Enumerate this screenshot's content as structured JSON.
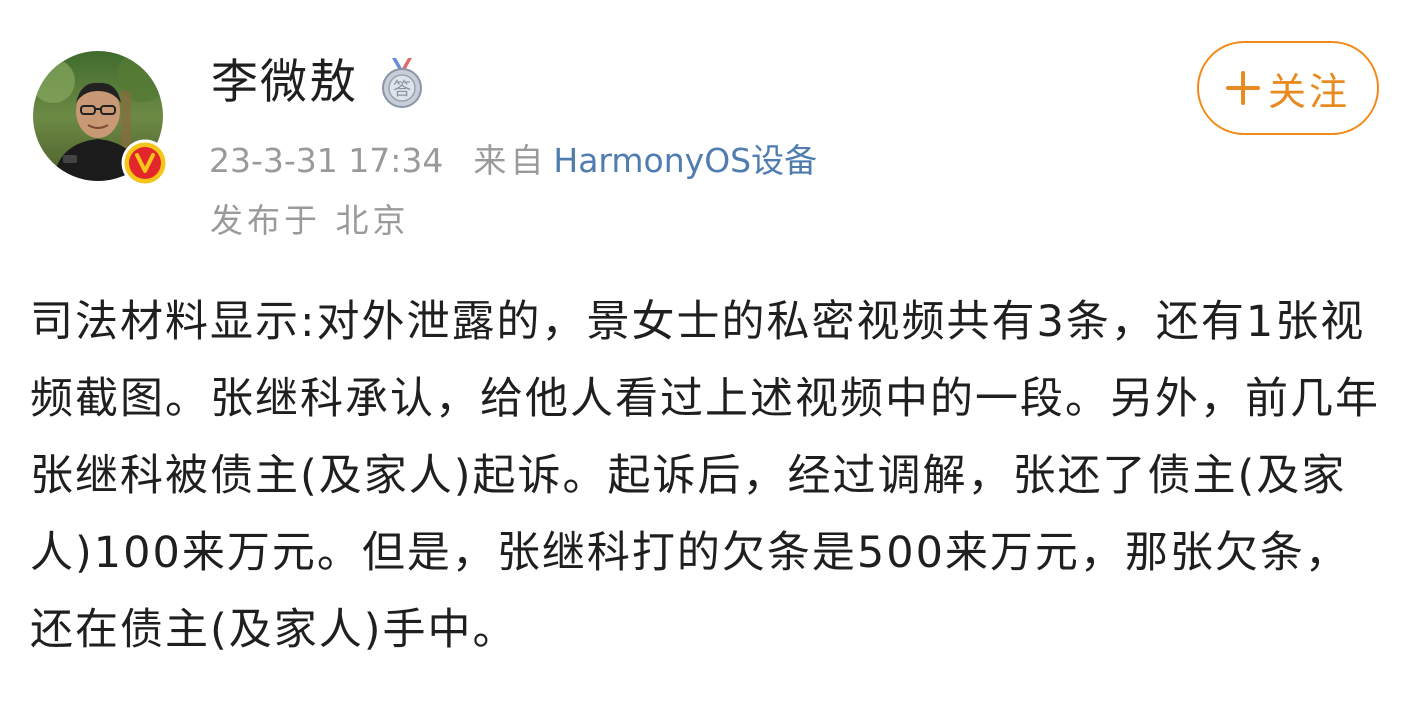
{
  "author": {
    "name": "李微敖",
    "avatar_icon": "user-avatar-photo",
    "verified_icon": "v-verified-badge-icon",
    "medal_icon": "medal-icon"
  },
  "post_meta": {
    "timestamp": "23-3-31 17:34",
    "source_prefix": "来自",
    "device": "HarmonyOS设备",
    "location": "发布于 北京"
  },
  "follow_button": {
    "label": "关注",
    "icon": "plus-icon"
  },
  "post": {
    "text": "司法材料显示:对外泄露的，景女士的私密视频共有3条，还有1张视频截图。张继科承认，给他人看过上述视频中的一段。另外，前几年张继科被债主(及家人)起诉。起诉后，经过调解，张还了债主(及家人)100来万元。但是，张继科打的欠条是500来万元，那张欠条，还在债主(及家人)手中。"
  },
  "colors": {
    "accent_orange": "#f28a1d",
    "link_blue": "#507daf",
    "meta_gray": "#9a9a9a",
    "text_dark": "#1f1f1f",
    "badge_red": "#e3262b",
    "badge_gold": "#f5c518"
  }
}
